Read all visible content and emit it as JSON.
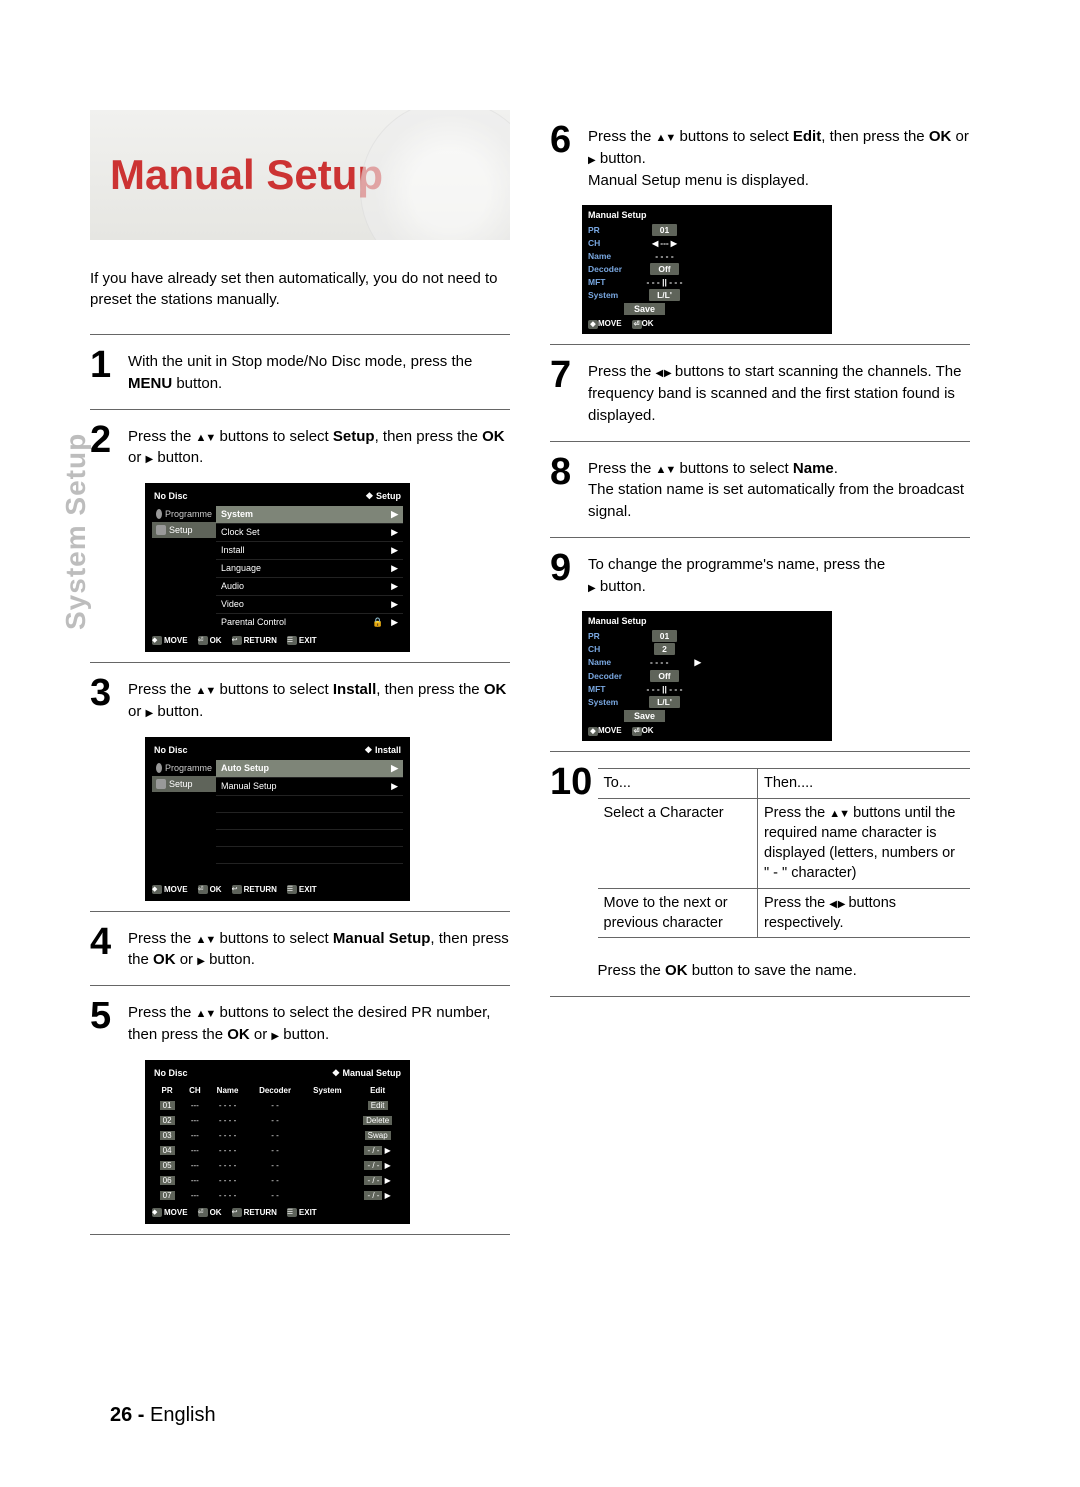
{
  "sideLabel": "System Setup",
  "title": "Manual Setup",
  "intro": "If you have already set then automatically, you do not need to preset the stations manually.",
  "steps": {
    "s1": {
      "num": "1",
      "pre": "With the unit in Stop mode/No Disc mode, press the ",
      "b1": "MENU",
      "post": " button."
    },
    "s2": {
      "num": "2",
      "t1": "Press the ",
      "t2": " buttons to select ",
      "b1": "Setup",
      "t3": ", then press the ",
      "b2": "OK",
      "t4": " or ",
      "t5": " button."
    },
    "s3": {
      "num": "3",
      "t1": "Press the ",
      "t2": " buttons to select ",
      "b1": "Install",
      "t3": ", then press the ",
      "b2": "OK",
      "t4": " or ",
      "t5": " button."
    },
    "s4": {
      "num": "4",
      "t1": "Press the ",
      "t2": " buttons to select ",
      "b1": "Manual Setup",
      "t3": ", then press the ",
      "b2": "OK",
      "t4": " or ",
      "t5": " button."
    },
    "s5": {
      "num": "5",
      "t1": "Press the ",
      "t2": " buttons to select the desired PR number, then press the ",
      "b2": "OK",
      "t4": " or ",
      "t5": " button."
    },
    "s6": {
      "num": "6",
      "t1": "Press the ",
      "t2": " buttons to select ",
      "b1": "Edit",
      "t3": ", then press the ",
      "b2": "OK",
      "t4": " or ",
      "t5": " button.",
      "t6": "Manual Setup menu is displayed."
    },
    "s7": {
      "num": "7",
      "t1": "Press the ",
      "t2": " buttons to start scanning the channels. The frequency band is scanned and the first station found is displayed."
    },
    "s8": {
      "num": "8",
      "t1": "Press the ",
      "t2": " buttons to select ",
      "b1": "Name",
      "t3": ".",
      "t4": "The station name is set automatically from the broadcast signal."
    },
    "s9": {
      "num": "9",
      "t1": "To change the programme's name, press the ",
      "t2": " button."
    },
    "s10": {
      "num": "10"
    }
  },
  "osd1": {
    "head_l": "No Disc",
    "head_r": "Setup",
    "nav": [
      "Programme",
      "Setup"
    ],
    "items": [
      "System",
      "Clock Set",
      "Install",
      "Language",
      "Audio",
      "Video",
      "Parental Control"
    ],
    "foot": [
      "MOVE",
      "OK",
      "RETURN",
      "EXIT"
    ]
  },
  "osd2": {
    "head_l": "No Disc",
    "head_r": "Install",
    "nav": [
      "Programme",
      "Setup"
    ],
    "items": [
      "Auto Setup",
      "Manual Setup"
    ],
    "foot": [
      "MOVE",
      "OK",
      "RETURN",
      "EXIT"
    ]
  },
  "osd3": {
    "head_l": "No Disc",
    "head_r": "Manual Setup",
    "cols": [
      "PR",
      "CH",
      "Name",
      "Decoder",
      "System",
      "Edit"
    ],
    "rows": [
      {
        "pr": "01",
        "ch": "---",
        "name": "- - - -",
        "dec": "- -",
        "sys": "",
        "edit": "Edit"
      },
      {
        "pr": "02",
        "ch": "---",
        "name": "- - - -",
        "dec": "- -",
        "sys": "",
        "edit": "Delete"
      },
      {
        "pr": "03",
        "ch": "---",
        "name": "- - - -",
        "dec": "- -",
        "sys": "",
        "edit": "Swap"
      },
      {
        "pr": "04",
        "ch": "---",
        "name": "- - - -",
        "dec": "- -",
        "sys": "",
        "edit": "- / -"
      },
      {
        "pr": "05",
        "ch": "---",
        "name": "- - - -",
        "dec": "- -",
        "sys": "",
        "edit": "- / -"
      },
      {
        "pr": "06",
        "ch": "---",
        "name": "- - - -",
        "dec": "- -",
        "sys": "",
        "edit": "- / -"
      },
      {
        "pr": "07",
        "ch": "---",
        "name": "- - - -",
        "dec": "- -",
        "sys": "",
        "edit": "- / -"
      }
    ],
    "foot": [
      "MOVE",
      "OK",
      "RETURN",
      "EXIT"
    ]
  },
  "ms1": {
    "title": "Manual Setup",
    "rows": [
      {
        "lbl": "PR",
        "val": "01",
        "box": true
      },
      {
        "lbl": "CH",
        "val": "---",
        "arrows": true
      },
      {
        "lbl": "Name",
        "val": "- - - -"
      },
      {
        "lbl": "Decoder",
        "val": "Off",
        "box": true
      },
      {
        "lbl": "MFT",
        "val": "- - - || - - -"
      },
      {
        "lbl": "System",
        "val": "L/L'",
        "box": true
      }
    ],
    "save": "Save",
    "foot": [
      "MOVE",
      "OK"
    ]
  },
  "ms2": {
    "title": "Manual Setup",
    "rows": [
      {
        "lbl": "PR",
        "val": "01",
        "box": true
      },
      {
        "lbl": "CH",
        "val": "2",
        "box": true
      },
      {
        "lbl": "Name",
        "val": "- - - -",
        "arrows_r": true
      },
      {
        "lbl": "Decoder",
        "val": "Off",
        "box": true
      },
      {
        "lbl": "MFT",
        "val": "- - - || - - -"
      },
      {
        "lbl": "System",
        "val": "L/L'",
        "box": true
      }
    ],
    "save": "Save",
    "foot": [
      "MOVE",
      "OK"
    ]
  },
  "table10": {
    "h1": "To...",
    "h2": "Then....",
    "r1a": "Select a Character",
    "r1b_1": "Press the ",
    "r1b_2": " buttons until the required name character is displayed (letters, numbers or \" - \" character)",
    "r2a": "Move to the next or previous character",
    "r2b_1": "Press the ",
    "r2b_2": " buttons respectively."
  },
  "save_note_1": "Press the ",
  "save_note_b": "OK",
  "save_note_2": " button to save the name.",
  "footer": {
    "page": "26 - ",
    "lang": "English"
  }
}
